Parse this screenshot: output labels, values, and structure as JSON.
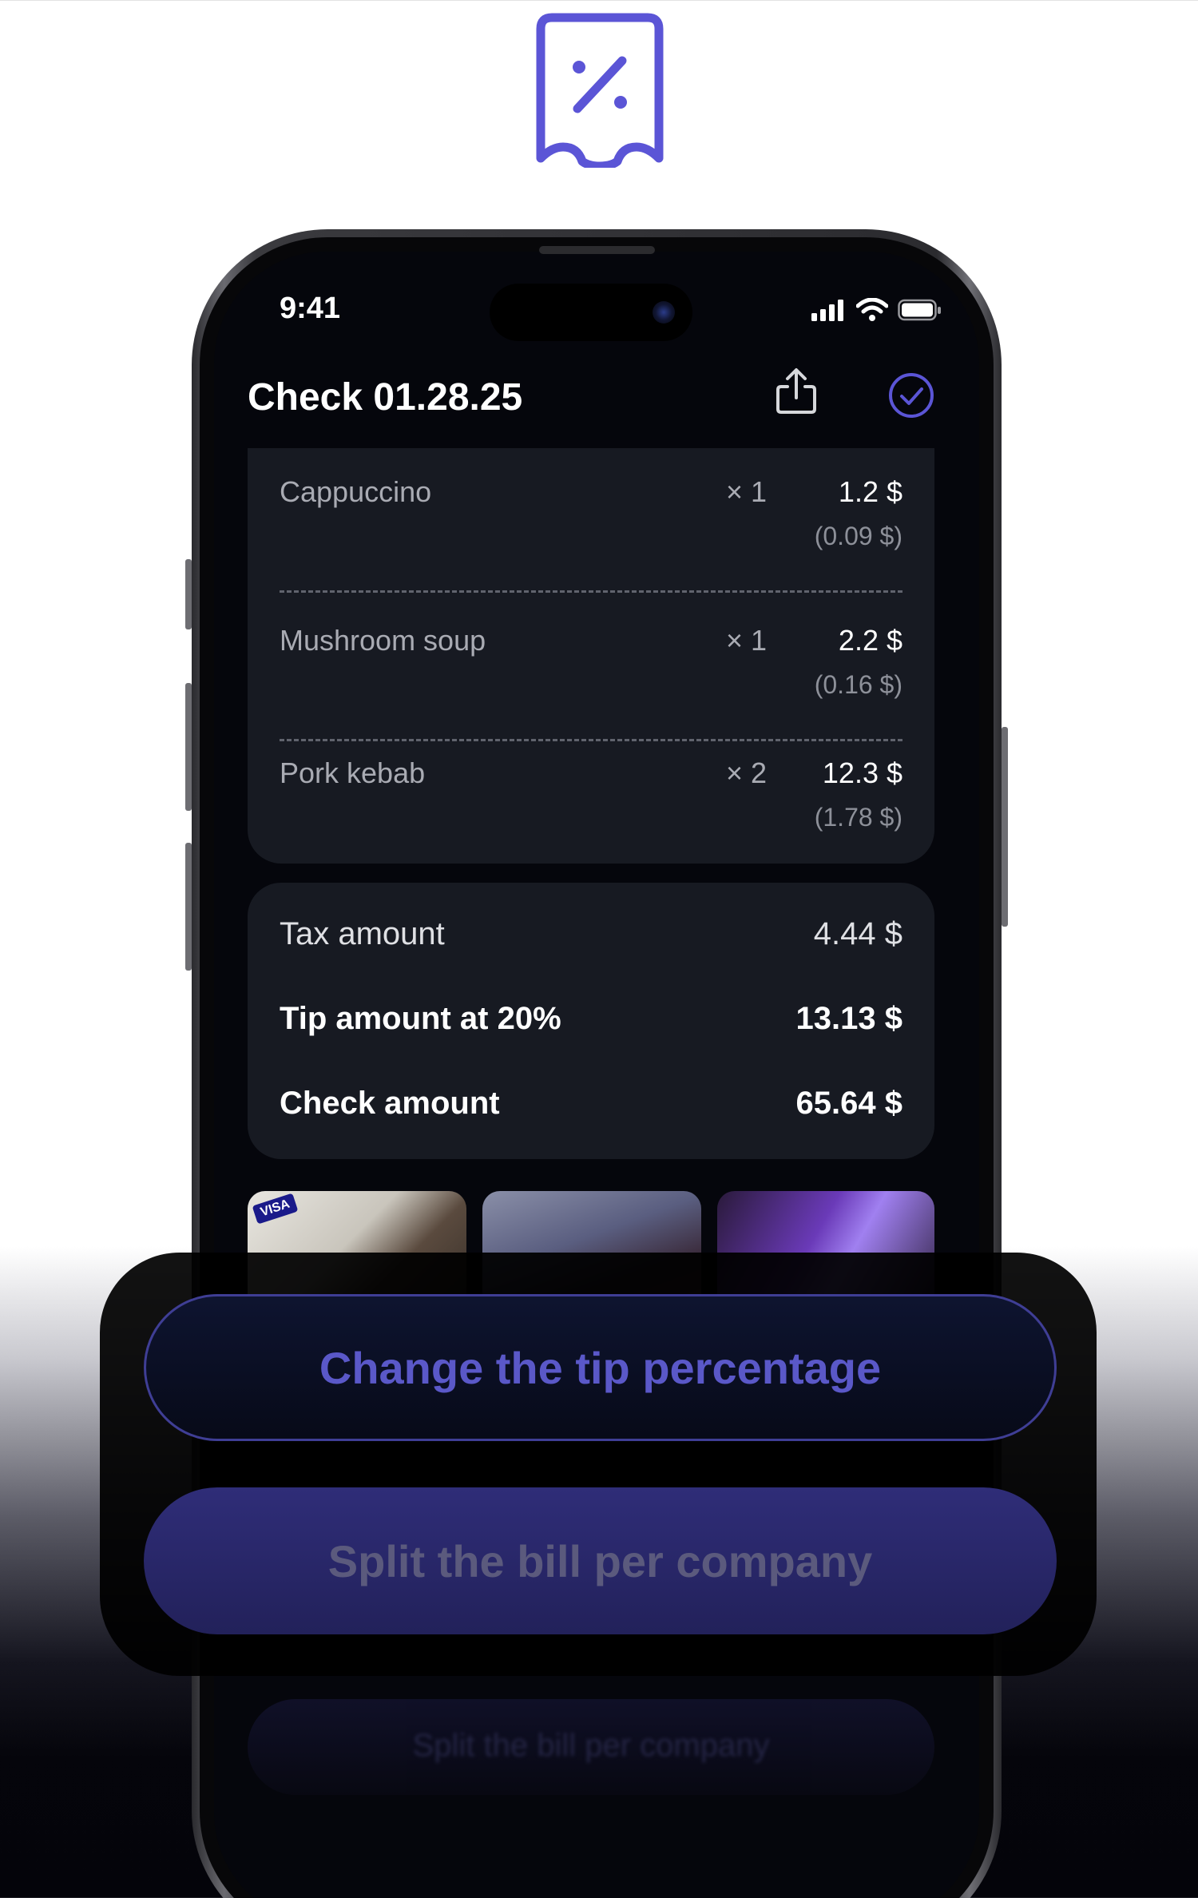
{
  "logo": {
    "icon": "receipt-percent-icon",
    "color": "#5b55d6"
  },
  "status_bar": {
    "time": "9:41"
  },
  "header": {
    "title": "Check 01.28.25",
    "share_icon": "share-icon",
    "confirm_icon": "check-circle-icon"
  },
  "items": [
    {
      "name": "Cappuccino",
      "qty": "× 1",
      "price": "1.2 $",
      "tax": "(0.09 $)"
    },
    {
      "name": "Mushroom soup",
      "qty": "× 1",
      "price": "2.2 $",
      "tax": "(0.16 $)"
    },
    {
      "name": "Pork kebab",
      "qty": "× 2",
      "price": "12.3 $",
      "tax": "(1.78 $)"
    }
  ],
  "totals": {
    "tax_label": "Tax amount",
    "tax_value": "4.44 $",
    "tip_label": "Tip amount at 20%",
    "tip_value": "13.13 $",
    "check_label": "Check amount",
    "check_value": "65.64 $"
  },
  "photos": {
    "visa_tag": "VISA"
  },
  "ghost_button": "Split the bill per company",
  "actions": {
    "change_tip": "Change the tip percentage",
    "split_bill": "Split the bill per company"
  },
  "colors": {
    "accent": "#5b55d6",
    "card": "#171a22",
    "screen": "#05060c"
  }
}
